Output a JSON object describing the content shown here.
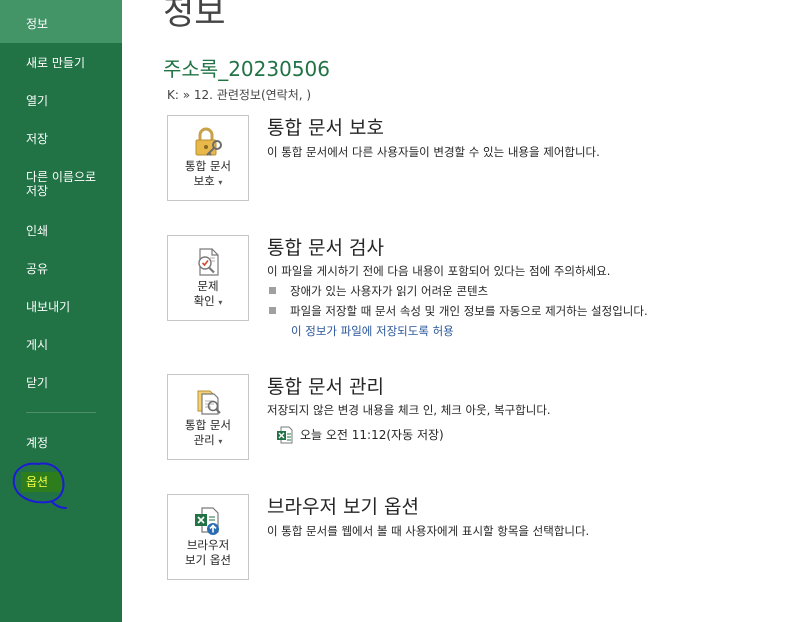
{
  "sidebar": {
    "items": [
      {
        "label": "정보"
      },
      {
        "label": "새로 만들기"
      },
      {
        "label": "열기"
      },
      {
        "label": "저장"
      },
      {
        "label": "다른 이름으로\n저장"
      },
      {
        "label": "인쇄"
      },
      {
        "label": "공유"
      },
      {
        "label": "내보내기"
      },
      {
        "label": "게시"
      },
      {
        "label": "닫기"
      },
      {
        "label": "계정"
      },
      {
        "label": "옵션"
      }
    ],
    "active_index": 0,
    "colors": {
      "background": "#217346",
      "active": "#439467",
      "option_highlight": "#2e7d1c",
      "option_text": "#f4ff44",
      "annotation": "#1b1bd6"
    }
  },
  "header": {
    "title": "정보",
    "file_name": "주소록_20230506",
    "path": "K: » 12. 관련정보(연락처, )"
  },
  "sections": {
    "protect": {
      "tile_line1": "통합 문서",
      "tile_line2": "보호",
      "title": "통합 문서 보호",
      "desc": "이 통합 문서에서 다른 사용자들이 변경할 수 있는 내용을 제어합니다."
    },
    "inspect": {
      "tile_line1": "문제",
      "tile_line2": "확인",
      "title": "통합 문서 검사",
      "desc": "이 파일을 게시하기 전에 다음 내용이 포함되어 있다는 점에 주의하세요.",
      "bullets": [
        "장애가 있는 사용자가 읽기 어려운 콘텐츠",
        "파일을 저장할 때 문서 속성 및 개인 정보를 자동으로 제거하는 설정입니다."
      ],
      "link": "이 정보가 파일에 저장되도록 허용"
    },
    "manage": {
      "tile_line1": "통합 문서",
      "tile_line2": "관리",
      "title": "통합 문서 관리",
      "desc": "저장되지 않은 변경 내용을 체크 인, 체크 아웃, 복구합니다.",
      "version": "오늘 오전 11:12(자동 저장)"
    },
    "browser": {
      "tile_line1": "브라우저",
      "tile_line2": "보기 옵션",
      "title": "브라우저 보기 옵션",
      "desc": "이 통합 문서를 웹에서 볼 때 사용자에게 표시할 항목을 선택합니다."
    }
  },
  "icons": {
    "protect": "lock-key-icon",
    "inspect": "inspect-document-icon",
    "manage": "manage-workbook-icon",
    "browser": "browser-view-options-icon",
    "version": "excel-file-icon"
  }
}
